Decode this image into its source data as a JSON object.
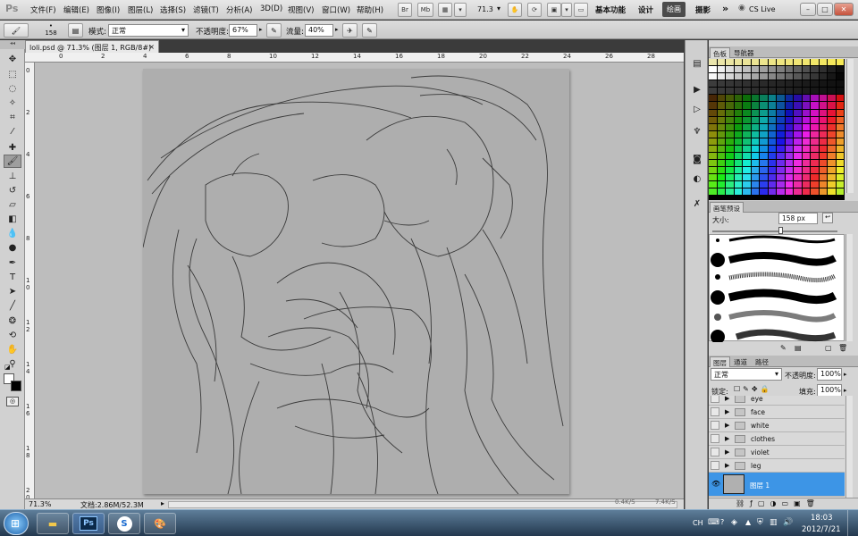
{
  "app": {
    "logo": "Ps",
    "menus": [
      "文件(F)",
      "编辑(E)",
      "图像(I)",
      "图层(L)",
      "选择(S)",
      "滤镜(T)",
      "分析(A)",
      "3D(D)",
      "视图(V)",
      "窗口(W)",
      "帮助(H)"
    ],
    "toolbar_buttons": [
      "Br",
      "Mb"
    ],
    "zoom_value": "71.3",
    "workspaces": [
      "基本功能",
      "设计",
      "绘画",
      "摄影"
    ],
    "more_label": "»",
    "cs_live": "CS Live",
    "window_controls": [
      "–",
      "□",
      "✕"
    ]
  },
  "options": {
    "brush_size": "158",
    "mode_label": "模式:",
    "mode_value": "正常",
    "opacity_label": "不透明度:",
    "opacity_value": "67%",
    "flow_label": "流量:",
    "flow_value": "40%"
  },
  "document": {
    "tab_title": "loli.psd @ 71.3% (图层 1, RGB/8#) *",
    "tab_close": "×",
    "ruler_h": [
      "0",
      "2",
      "4",
      "6",
      "8",
      "10",
      "12",
      "14",
      "16",
      "18",
      "20",
      "22",
      "24",
      "26",
      "28"
    ],
    "ruler_v": [
      "0",
      "2",
      "4",
      "6",
      "8",
      "1 0",
      "1 2",
      "1 4",
      "1 6",
      "1 8",
      "2 0"
    ],
    "status_zoom": "71.3%",
    "status_doc": "文档:2.86M/52.3M"
  },
  "panels": {
    "swatch_tabs": [
      "色板",
      "导航器"
    ],
    "brush_tab": "画笔预设",
    "brush_size_label": "大小:",
    "brush_size_value": "158 px",
    "layer_tabs": [
      "图层",
      "通道",
      "路径"
    ],
    "blend_mode": "正常",
    "layer_opacity_label": "不透明度:",
    "layer_opacity_value": "100%",
    "lock_label": "锁定:",
    "fill_label": "填充:",
    "fill_value": "100%",
    "layers": [
      "eye",
      "face",
      "white",
      "clothes",
      "violet",
      "leg"
    ],
    "active_layer": "图层 1"
  },
  "taskbar": {
    "ps_label": "Ps",
    "s_label": "S",
    "lang": "CH",
    "time": "18:03",
    "date": "2012/7/21",
    "net_speed_1": "0.4K/S",
    "net_speed_2": "7.4K/S"
  },
  "colors": {
    "accent_active_layer": "#3d95e6",
    "canvas": "#aeaeae",
    "canvas_bg": "#bdbdbd",
    "foreground": "#000000",
    "background": "#ffffff"
  },
  "icons": [
    "move-icon",
    "marquee-icon",
    "lasso-icon",
    "quick-select-icon",
    "crop-icon",
    "eyedropper-icon",
    "healing-icon",
    "brush-icon",
    "stamp-icon",
    "history-brush-icon",
    "eraser-icon",
    "gradient-icon",
    "blur-icon",
    "dodge-icon",
    "pen-icon",
    "type-icon",
    "path-select-icon",
    "shape-icon",
    "3d-rotate-icon",
    "3d-camera-icon",
    "hand-icon",
    "zoom-icon"
  ]
}
